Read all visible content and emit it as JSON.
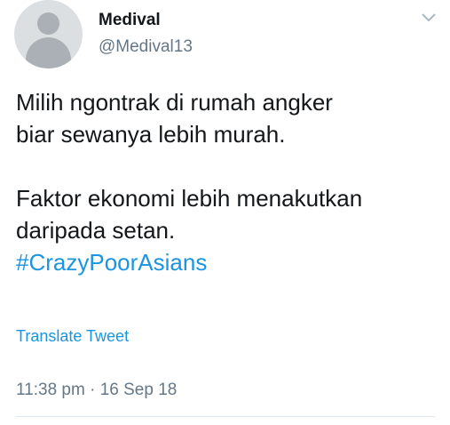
{
  "user": {
    "display_name": "Medival",
    "handle": "@Medival13",
    "avatar_icon": "default-profile-avatar-icon"
  },
  "menu": {
    "icon": "chevron-down-icon"
  },
  "tweet": {
    "lines": [
      "Milih ngontrak di rumah angker",
      "biar sewanya lebih murah.",
      "Faktor ekonomi lebih menakutkan",
      "daripada setan."
    ],
    "hashtag": "#CrazyPoorAsians"
  },
  "translate_label": "Translate Tweet",
  "timestamp": "11:38 pm · 16 Sep 18",
  "colors": {
    "link": "#1b95e0",
    "secondary_text": "#657786",
    "primary_text": "#14171a",
    "avatar_bg": "#dcdfe2",
    "avatar_fg": "#aab0b5"
  }
}
